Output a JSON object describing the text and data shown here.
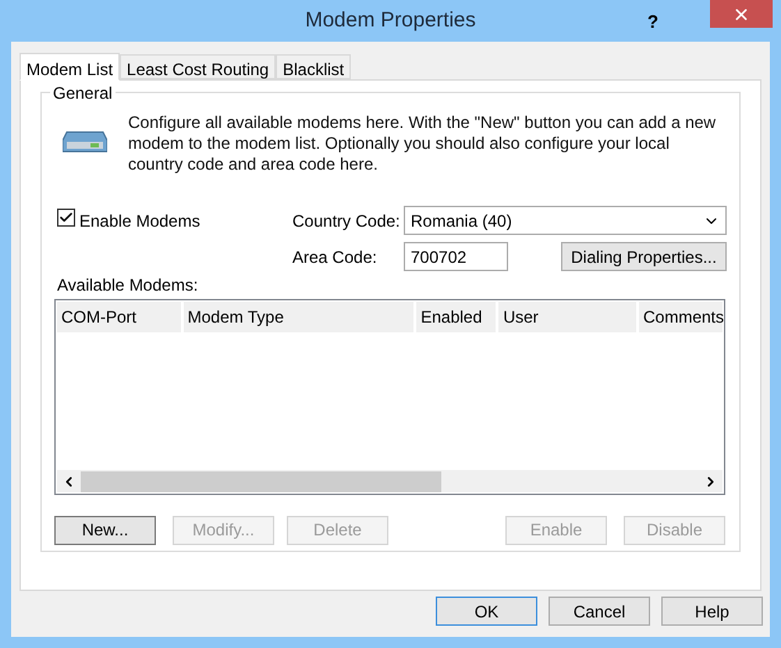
{
  "window": {
    "title": "Modem Properties",
    "help": "?"
  },
  "tabs": [
    {
      "label": "Modem List",
      "selected": true
    },
    {
      "label": "Least Cost Routing",
      "selected": false
    },
    {
      "label": "Blacklist",
      "selected": false
    }
  ],
  "general": {
    "legend": "General",
    "description": "Configure all available modems here. With the \"New\" button you can add a new modem to the modem list. Optionally you should also configure your local country code and area code here."
  },
  "enable_modems": {
    "label": "Enable Modems",
    "checked": true
  },
  "country_code": {
    "label": "Country Code:",
    "value": "Romania (40)"
  },
  "area_code": {
    "label": "Area Code:",
    "value": "700702"
  },
  "dialing_button": {
    "label": "Dialing Properties..."
  },
  "available_modems": {
    "label": "Available Modems:",
    "columns": [
      "COM-Port",
      "Modem Type",
      "Enabled",
      "User",
      "Comments"
    ]
  },
  "list_buttons": [
    {
      "label": "New...",
      "disabled": false
    },
    {
      "label": "Modify...",
      "disabled": true
    },
    {
      "label": "Delete",
      "disabled": true
    },
    {
      "label": "Enable",
      "disabled": true
    },
    {
      "label": "Disable",
      "disabled": true
    }
  ],
  "dialog_buttons": [
    {
      "label": "OK",
      "default": true
    },
    {
      "label": "Cancel",
      "default": false
    },
    {
      "label": "Help",
      "default": false
    }
  ]
}
